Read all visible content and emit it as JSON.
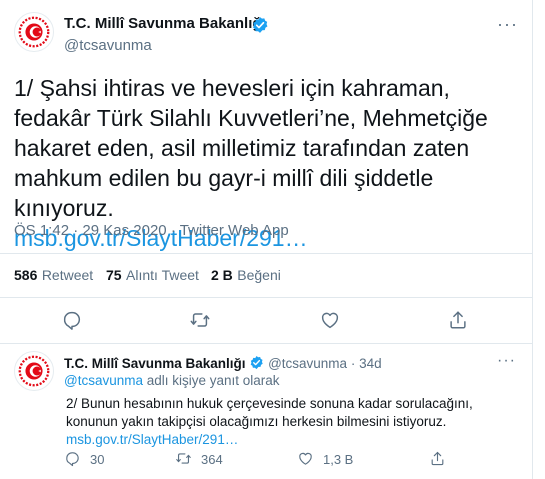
{
  "main_tweet": {
    "display_name": "T.C. Millî Savunma Bakanlığı",
    "handle": "@tcsavunma",
    "text": "1/ Şahsi ihtiras ve hevesleri için kahraman, fedakâr Türk Silahlı Kuvvetleri’ne, Mehmetçiğe hakaret eden, asil milletimiz tarafından zaten mahkum edilen bu gayr-i millî dili şiddetle kınıyoruz.",
    "link": "msb.gov.tr/SlaytHaber/291…",
    "time": "ÖS 1:42",
    "date": "29 Kas 2020",
    "separator": "·",
    "source": "Twitter Web App",
    "stats": {
      "retweets": "586",
      "retweets_label": "Retweet",
      "quotes": "75",
      "quotes_label": "Alıntı Tweet",
      "likes": "2 B",
      "likes_label": "Beğeni"
    }
  },
  "reply_tweet": {
    "display_name": "T.C. Millî Savunma Bakanlığı",
    "handle": "@tcsavunma",
    "separator": "·",
    "age": "34d",
    "replying_mention": "@tcsavunma",
    "replying_suffix": "adlı kişiye yanıt olarak",
    "text": "2/ Bunun hesabının hukuk çerçevesinde sonuna kadar sorulacağını, konunun yakın takipçisi olacağımızı herkesin bilmesini istiyoruz.",
    "link": "msb.gov.tr/SlaytHaber/291…",
    "counts": {
      "replies": "30",
      "retweets": "364",
      "likes": "1,3 B"
    }
  },
  "icons": [
    "reply-icon",
    "retweet-icon",
    "like-icon",
    "share-icon",
    "verified-icon",
    "more-icon"
  ],
  "colors": {
    "link": "#1b95e0",
    "verified": "#1da1f2",
    "logo_red": "#e30a17",
    "secondary_text": "#5b7083"
  }
}
